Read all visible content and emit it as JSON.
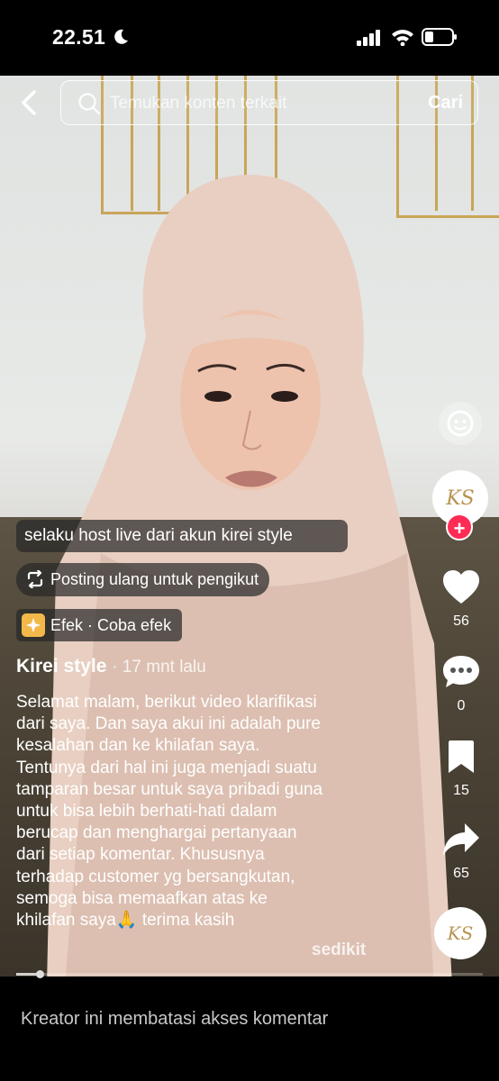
{
  "status_bar": {
    "time": "22.51"
  },
  "search": {
    "placeholder": "Temukan konten terkait",
    "button_label": "Cari"
  },
  "overlay": {
    "caption_chip": "selaku host live dari akun kirei style",
    "repost_label": "Posting ulang untuk pengikut",
    "effect_label": "Efek · Coba efek"
  },
  "post": {
    "author": "Kirei style",
    "time_ago": "· 17 mnt lalu",
    "caption_lines": [
      "Selamat malam, berikut video klarifikasi",
      "dari saya. Dan saya akui ini adalah pure",
      "kesalahan dan ke khilafan saya.",
      "Tentunya dari hal ini juga menjadi suatu",
      "tamparan besar untuk saya pribadi guna",
      "untuk bisa lebih berhati-hati dalam",
      "berucap dan menghargai pertanyaan",
      "dari setiap komentar. Khususnya",
      "terhadap customer yg bersangkutan,",
      "semoga bisa memaafkan atas ke",
      "khilafan saya🙏  terima kasih"
    ],
    "less_label": "sedikit",
    "avatar_text": "KS"
  },
  "actions": {
    "likes": "56",
    "comments": "0",
    "saves": "15",
    "shares": "65"
  },
  "progress": {
    "fraction": 0.05
  },
  "footer": {
    "comment_notice": "Kreator ini membatasi akses komentar"
  },
  "colors": {
    "follow": "#fe2c55",
    "frame_gold": "#c9a558"
  },
  "icons": [
    "moon-icon",
    "signal-icon",
    "wifi-icon",
    "battery-icon",
    "back-icon",
    "search-icon",
    "face-icon",
    "heart-icon",
    "comment-icon",
    "bookmark-icon",
    "share-icon",
    "repost-icon",
    "effect-icon"
  ]
}
